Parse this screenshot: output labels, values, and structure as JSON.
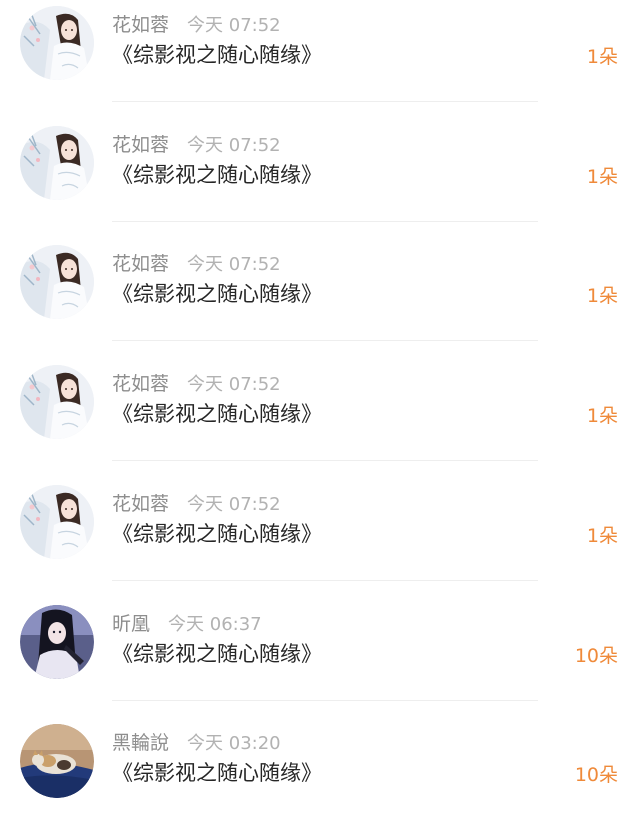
{
  "messages": [
    {
      "name": "花如蓉",
      "time": "今天 07:52",
      "title": "《综影视之随心随缘》",
      "gift": "1朵",
      "avatar": "avatar-lady-white"
    },
    {
      "name": "花如蓉",
      "time": "今天 07:52",
      "title": "《综影视之随心随缘》",
      "gift": "1朵",
      "avatar": "avatar-lady-white"
    },
    {
      "name": "花如蓉",
      "time": "今天 07:52",
      "title": "《综影视之随心随缘》",
      "gift": "1朵",
      "avatar": "avatar-lady-white"
    },
    {
      "name": "花如蓉",
      "time": "今天 07:52",
      "title": "《综影视之随心随缘》",
      "gift": "1朵",
      "avatar": "avatar-lady-white"
    },
    {
      "name": "花如蓉",
      "time": "今天 07:52",
      "title": "《综影视之随心随缘》",
      "gift": "1朵",
      "avatar": "avatar-lady-white"
    },
    {
      "name": "昕凰",
      "time": "今天 06:37",
      "title": "《综影视之随心随缘》",
      "gift": "10朵",
      "avatar": "avatar-dark-haired-girl"
    },
    {
      "name": "黑輪說",
      "time": "今天 03:20",
      "title": "《综影视之随心随缘》",
      "gift": "10朵",
      "avatar": "avatar-cat"
    }
  ],
  "colors": {
    "name": "#8e8e8e",
    "time": "#b2b2b2",
    "title": "#262626",
    "gift": "#ef8a3a",
    "divider": "#eeeeee"
  }
}
